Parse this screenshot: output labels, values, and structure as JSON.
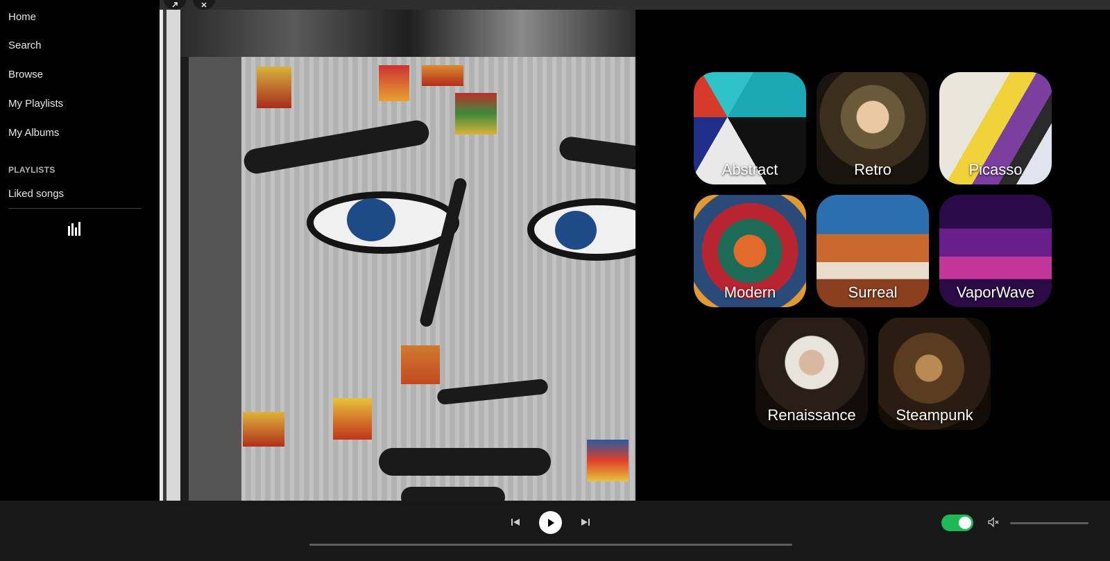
{
  "sidebar": {
    "nav": [
      {
        "label": "Home"
      },
      {
        "label": "Search"
      },
      {
        "label": "Browse"
      },
      {
        "label": "My Playlists"
      },
      {
        "label": "My Albums"
      }
    ],
    "section_title": "PLAYLISTS",
    "playlists": [
      {
        "label": "Liked songs"
      }
    ],
    "library_icon": "library-bars-icon"
  },
  "topbar": {
    "back_icon": "arrow-icon",
    "close_icon": "close-icon"
  },
  "genres": [
    {
      "label": "Abstract"
    },
    {
      "label": "Retro"
    },
    {
      "label": "Picasso"
    },
    {
      "label": "Modern"
    },
    {
      "label": "Surreal"
    },
    {
      "label": "VaporWave"
    },
    {
      "label": "Renaissance"
    },
    {
      "label": "Steampunk"
    }
  ],
  "player": {
    "prev_icon": "skip-previous-icon",
    "play_icon": "play-icon",
    "next_icon": "skip-next-icon",
    "toggle_on": true,
    "accent_color": "#1db954",
    "mute_icon": "volume-muted-icon",
    "progress_fraction": 0,
    "volume_fraction": 0
  }
}
